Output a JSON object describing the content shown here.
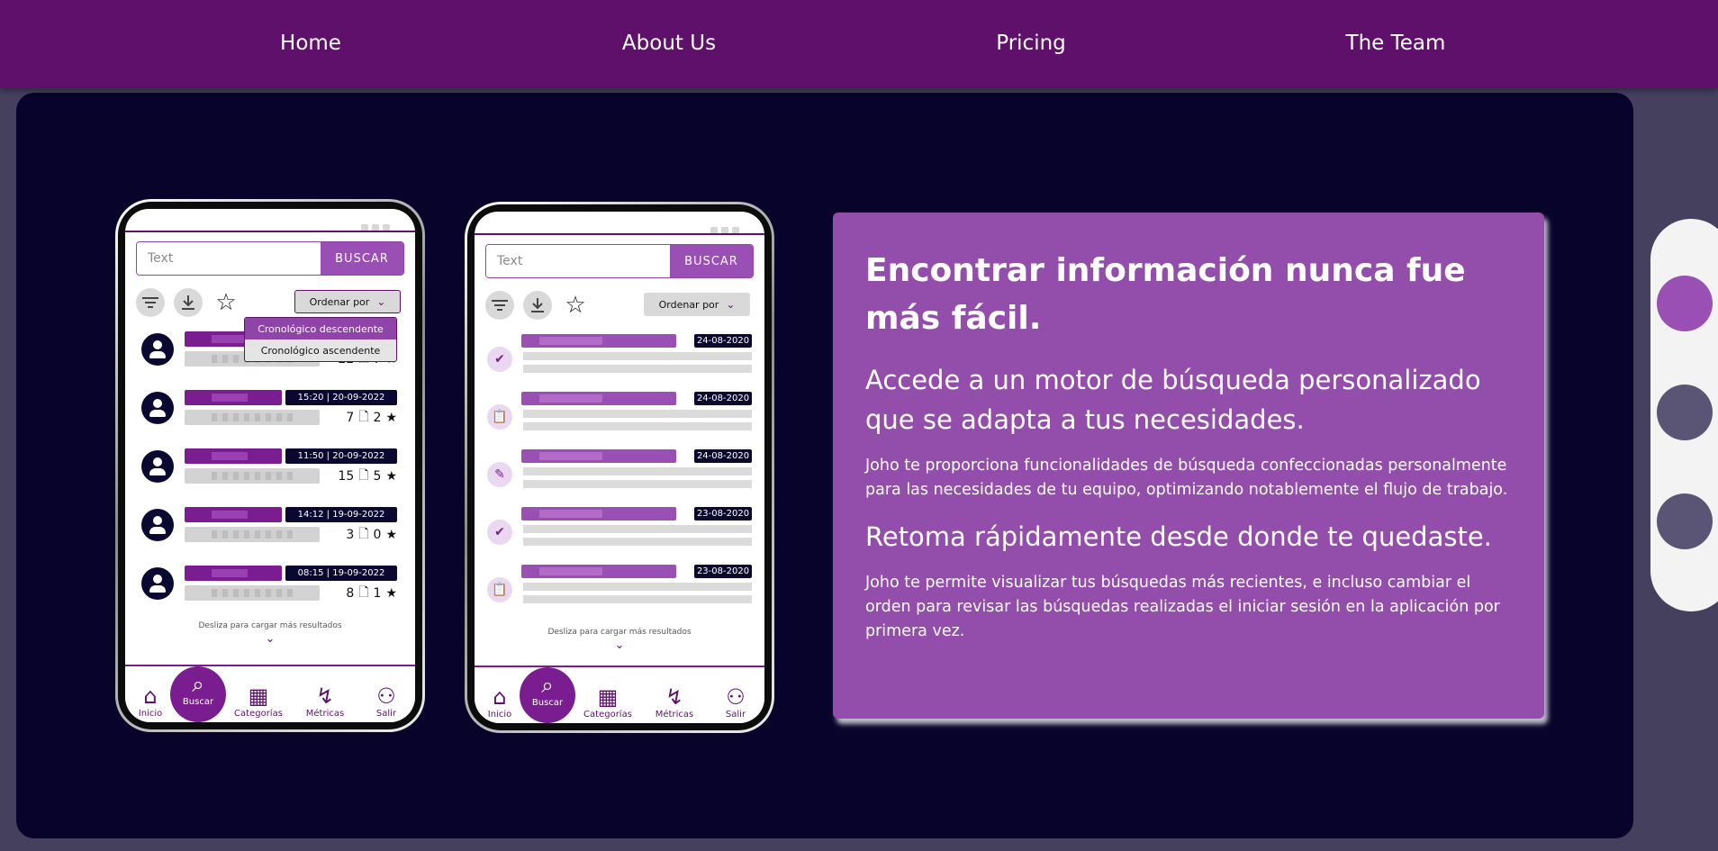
{
  "nav": {
    "items": [
      {
        "label": "Home"
      },
      {
        "label": "About Us"
      },
      {
        "label": "Pricing"
      },
      {
        "label": "The Team"
      }
    ]
  },
  "colors": {
    "nav_bg": "#5e106a",
    "panel_bg": "#07032a",
    "card_bg": "#934daa",
    "accent": "#7a1d90",
    "pager_active": "#9a4fb5",
    "pager_inactive": "#5a5475"
  },
  "phone1": {
    "search_placeholder": "Text",
    "search_button": "BUSCAR",
    "sort_label": "Ordenar por",
    "dropdown": {
      "options": [
        "Cronológico descendente",
        "Cronológico ascendente"
      ],
      "selected": "Cronológico descendente"
    },
    "rows": [
      {
        "timestamp": "",
        "docs": "22",
        "stars": "7"
      },
      {
        "timestamp": "15:20  |  20-09-2022",
        "docs": "7",
        "stars": "2"
      },
      {
        "timestamp": "11:50  |  20-09-2022",
        "docs": "15",
        "stars": "5"
      },
      {
        "timestamp": "14:12  |  19-09-2022",
        "docs": "3",
        "stars": "0"
      },
      {
        "timestamp": "08:15  |  19-09-2022",
        "docs": "8",
        "stars": "1"
      }
    ],
    "load_more": "Desliza para cargar más resultados",
    "bottom_nav": [
      "Inicio",
      "Buscar",
      "Categorías",
      "Métricas",
      "Salir"
    ],
    "active_tab": "Buscar"
  },
  "phone2": {
    "search_placeholder": "Text",
    "search_button": "BUSCAR",
    "sort_label": "Ordenar por",
    "rows": [
      {
        "date": "24-08-2020",
        "icon": "tag-check-icon"
      },
      {
        "date": "24-08-2020",
        "icon": "clipboard-icon"
      },
      {
        "date": "24-08-2020",
        "icon": "document-edit-icon"
      },
      {
        "date": "23-08-2020",
        "icon": "tag-check-icon"
      },
      {
        "date": "23-08-2020",
        "icon": "clipboard-icon"
      }
    ],
    "load_more": "Desliza para cargar más resultados",
    "bottom_nav": [
      "Inicio",
      "Buscar",
      "Categorías",
      "Métricas",
      "Salir"
    ],
    "active_tab": "Buscar"
  },
  "card": {
    "title": "Encontrar información nunca fue más fácil.",
    "subtitle1": "Accede a un motor de búsqueda personalizado que se adapta a tus necesidades.",
    "body1": "Joho te proporciona funcionalidades de búsqueda confeccionadas personalmente para las necesidades de tu equipo, optimizando notablemente el flujo de trabajo.",
    "subtitle2": "Retoma rápidamente desde donde te quedaste.",
    "body2": "Joho te permite visualizar tus búsquedas más recientes, e incluso cambiar el orden para revisar las búsquedas realizadas el iniciar sesión en la aplicación por primera vez."
  },
  "pager": {
    "count": 3,
    "active_index": 0
  }
}
